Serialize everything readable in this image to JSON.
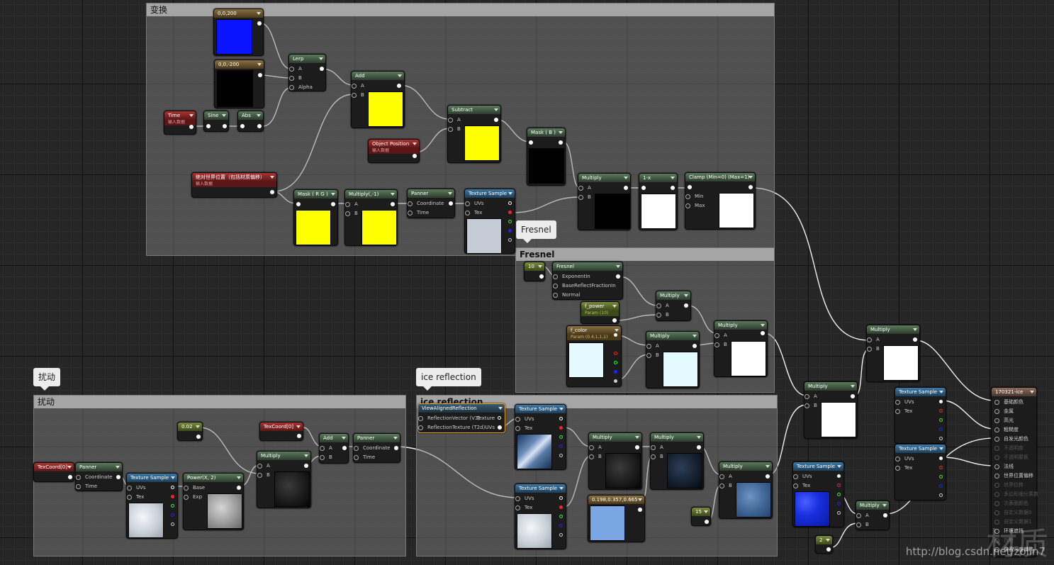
{
  "comments": {
    "transform": "变换",
    "fresnel": "Fresnel",
    "disturb": "扰动",
    "ice_reflection": "ice reflection"
  },
  "bubbles": {
    "fresnel": "Fresnel",
    "disturb": "扰动",
    "ice_reflection": "ice reflection"
  },
  "nodes": {
    "const_top": "0,0,200",
    "const_bottom": "0,0,-200",
    "time": "Time",
    "time_sub": "输入数据",
    "sine": "Sine",
    "abs": "Abs",
    "lerp": "Lerp",
    "lerp_pins": [
      "A",
      "B",
      "Alpha"
    ],
    "add": "Add",
    "object_position": "Object Position",
    "object_position_sub": "输入数据",
    "subtract": "Subtract",
    "mask_b": "Mask ( B )",
    "abs_world_pos": "绝对世界位置（包括材质偏移）",
    "abs_world_pos_sub": "输入数据",
    "mask_rg": "Mask ( R G )",
    "multiply_neg1": "Multiply(,-1)",
    "panner": "Panner",
    "panner_pins": [
      "Coordinate",
      "Time"
    ],
    "texture_sample": "Texture Sample",
    "ts_pins": [
      "UVs",
      "Tex"
    ],
    "multiply": "Multiply",
    "one_minus": "1-x",
    "clamp": "Clamp (Min=0) (Max=1)",
    "clamp_pins": [
      "Min",
      "Max"
    ],
    "pins_ab": [
      "A",
      "B"
    ],
    "const_10": "10",
    "fresnel": "Fresnel",
    "fresnel_pins": [
      "ExponentIn",
      "BaseReflectFractionIn",
      "Normal"
    ],
    "f_power": "f_power",
    "f_power_sub": "Param (10)",
    "f_color": "f_color",
    "f_color_sub": "Param (0.4,1,1,1)",
    "texcoord": "TexCoord[0]",
    "const_002": "0.02",
    "power": "Power(X, 2)",
    "power_pins": [
      "Base",
      "Exp"
    ],
    "view_reflection": "ViewAlignedReflection",
    "view_reflection_pins": [
      "ReflectionVector (V3)",
      "ReflectionTexture (T2d)"
    ],
    "view_reflection_outs": [
      "Texture",
      "UVs"
    ],
    "const_color": "0.198,0.357,0.665",
    "const_15": "15",
    "const_2": "2"
  },
  "result_node": {
    "title": "170321-ice",
    "pins": [
      {
        "label": "基础颜色",
        "active": true
      },
      {
        "label": "金属",
        "active": true
      },
      {
        "label": "高光",
        "active": true
      },
      {
        "label": "粗糙度",
        "active": true
      },
      {
        "label": "自发光颜色",
        "active": true
      },
      {
        "label": "不透明度",
        "active": false
      },
      {
        "label": "不透明蒙板",
        "active": false
      },
      {
        "label": "法线",
        "active": true
      },
      {
        "label": "世界位置偏移",
        "active": true
      },
      {
        "label": "世界位移",
        "active": false
      },
      {
        "label": "多边形细分乘数",
        "active": false
      },
      {
        "label": "次表面颜色",
        "active": false
      },
      {
        "label": "自定义数据0",
        "active": false
      },
      {
        "label": "自定义数据1",
        "active": false
      },
      {
        "label": "环境遮挡",
        "active": true
      },
      {
        "label": "折射",
        "active": false
      },
      {
        "label": "像素深度偏移",
        "active": true
      }
    ]
  },
  "watermark": "http://blog.csdn.net/zolin7",
  "watermark_logo": "材质",
  "colors": {
    "blue_preview": "#0a14ff",
    "yellow_preview": "#ffff00",
    "black_preview": "#000000",
    "white_preview": "#ffffff",
    "grey_preview": "#c5ccd6",
    "cyan_preview": "#e3fbff",
    "const_color_preview": "#7aa6e3",
    "noise_blue": "#1a2fe0"
  }
}
